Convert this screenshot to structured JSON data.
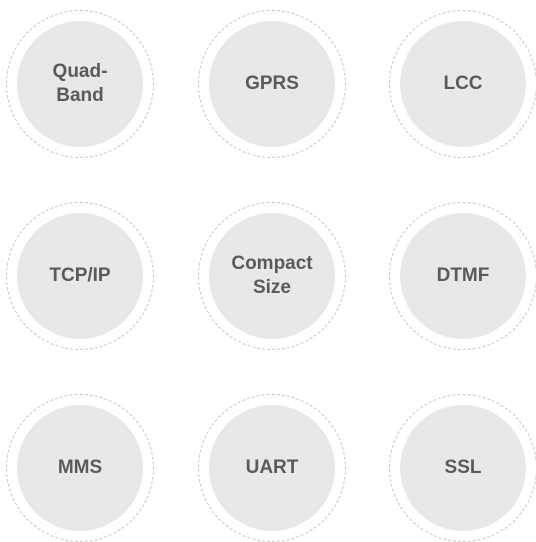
{
  "features": [
    {
      "label": "Quad-\nBand"
    },
    {
      "label": "GPRS"
    },
    {
      "label": "LCC"
    },
    {
      "label": "TCP/IP"
    },
    {
      "label": "Compact\nSize"
    },
    {
      "label": "DTMF"
    },
    {
      "label": "MMS"
    },
    {
      "label": "UART"
    },
    {
      "label": "SSL"
    }
  ],
  "colors": {
    "badge_fill": "#e8e8e8",
    "badge_outline": "#c4c4c4",
    "label_text": "#5a5a5a",
    "background": "#ffffff"
  }
}
